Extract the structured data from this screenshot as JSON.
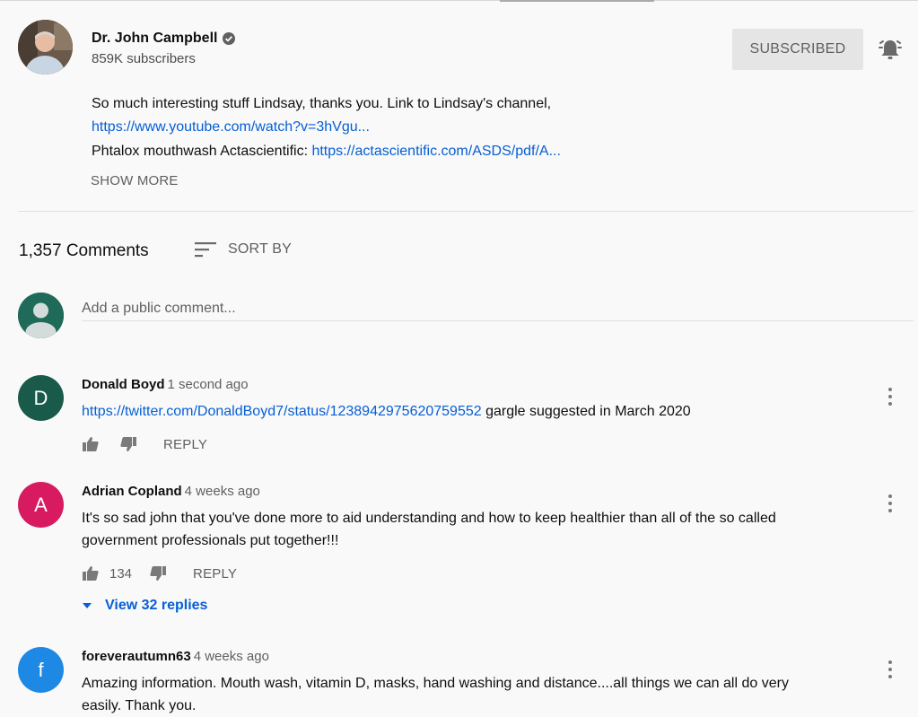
{
  "channel": {
    "name": "Dr. John Campbell",
    "subscribers": "859K subscribers",
    "subscribe_label": "SUBSCRIBED"
  },
  "description": {
    "line1": "So much interesting stuff Lindsay, thanks you. Link to Lindsay's channel,",
    "link1": "https://www.youtube.com/watch?v=3hVgu...",
    "line3_text": "Phtalox mouthwash Actascientific: ",
    "link2": "https://actascientific.com/ASDS/pdf/A...",
    "show_more": "SHOW MORE"
  },
  "comments_header": {
    "count_label": "1,357 Comments",
    "sort_label": "SORT BY"
  },
  "add_comment": {
    "placeholder": "Add a public comment..."
  },
  "comments": [
    {
      "avatar_letter": "D",
      "avatar_color": "#1a5a4a",
      "author": "Donald Boyd",
      "time": "1 second ago",
      "link": "https://twitter.com/DonaldBoyd7/status/1238942975620759552",
      "text": " gargle suggested in March 2020",
      "likes": "",
      "reply_label": "REPLY"
    },
    {
      "avatar_letter": "A",
      "avatar_color": "#d81b60",
      "author": "Adrian Copland",
      "time": "4 weeks ago",
      "text_line1": "It's so sad john that you've done more to aid understanding and how to keep healthier  than all of the so called",
      "text_line2": "government professionals put together!!!",
      "likes": "134",
      "reply_label": "REPLY",
      "view_replies": "View 32 replies"
    },
    {
      "avatar_letter": "f",
      "avatar_color": "#1e88e5",
      "author": "foreverautumn63",
      "time": "4 weeks ago",
      "text_line1": "Amazing information. Mouth wash, vitamin D,  masks, hand washing and distance....all things we can all do very",
      "text_line2": "easily. Thank you."
    }
  ]
}
